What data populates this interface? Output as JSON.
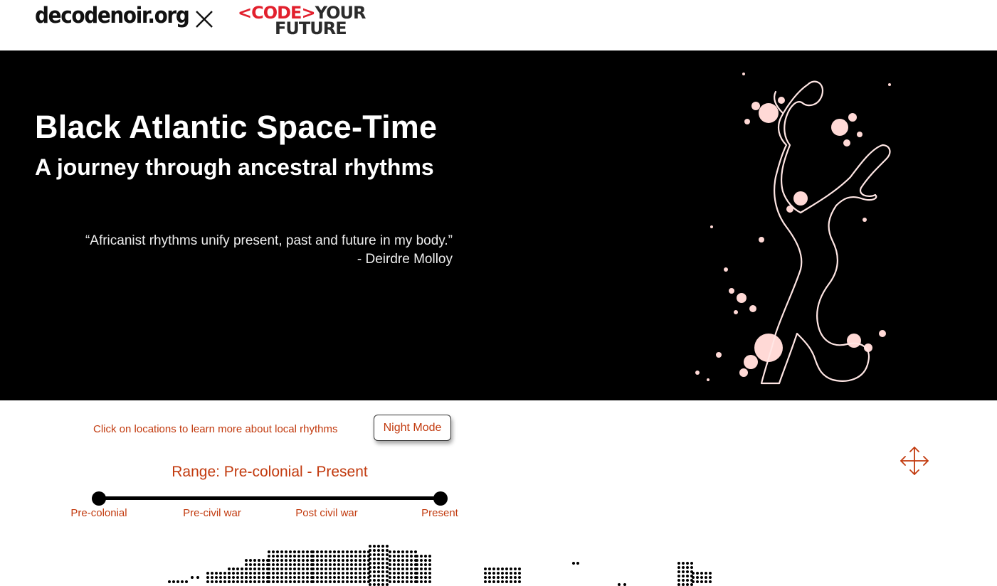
{
  "header": {
    "brand": "decodenoir.org",
    "partner_logo": {
      "line1_left": "<CODE>",
      "line1_right": "YOUR",
      "line2": "FUTURE"
    }
  },
  "hero": {
    "title": "Black Atlantic Space-Time",
    "subtitle": "A journey through ancestral rhythms",
    "quote": "“Africanist rhythms unify present, past and future in my body.”",
    "attribution": "- Deirdre Molloy"
  },
  "controls": {
    "hint": "Click on locations to learn more about local rhythms",
    "night_mode_label": "Night Mode",
    "range_title": "Range: Pre-colonial - Present",
    "ticks": [
      "Pre-colonial",
      "Pre-civil war",
      "Post civil war",
      "Present"
    ],
    "selected_range": [
      "Pre-colonial",
      "Present"
    ]
  },
  "colors": {
    "accent": "#c23a0e",
    "hero_bg": "#000000",
    "splash": "#ffd9d6",
    "logo_red": "#e2202d"
  },
  "icons": {
    "close": "close-icon",
    "move": "move-arrows-icon",
    "dancer": "dancer-silhouette-illustration"
  }
}
